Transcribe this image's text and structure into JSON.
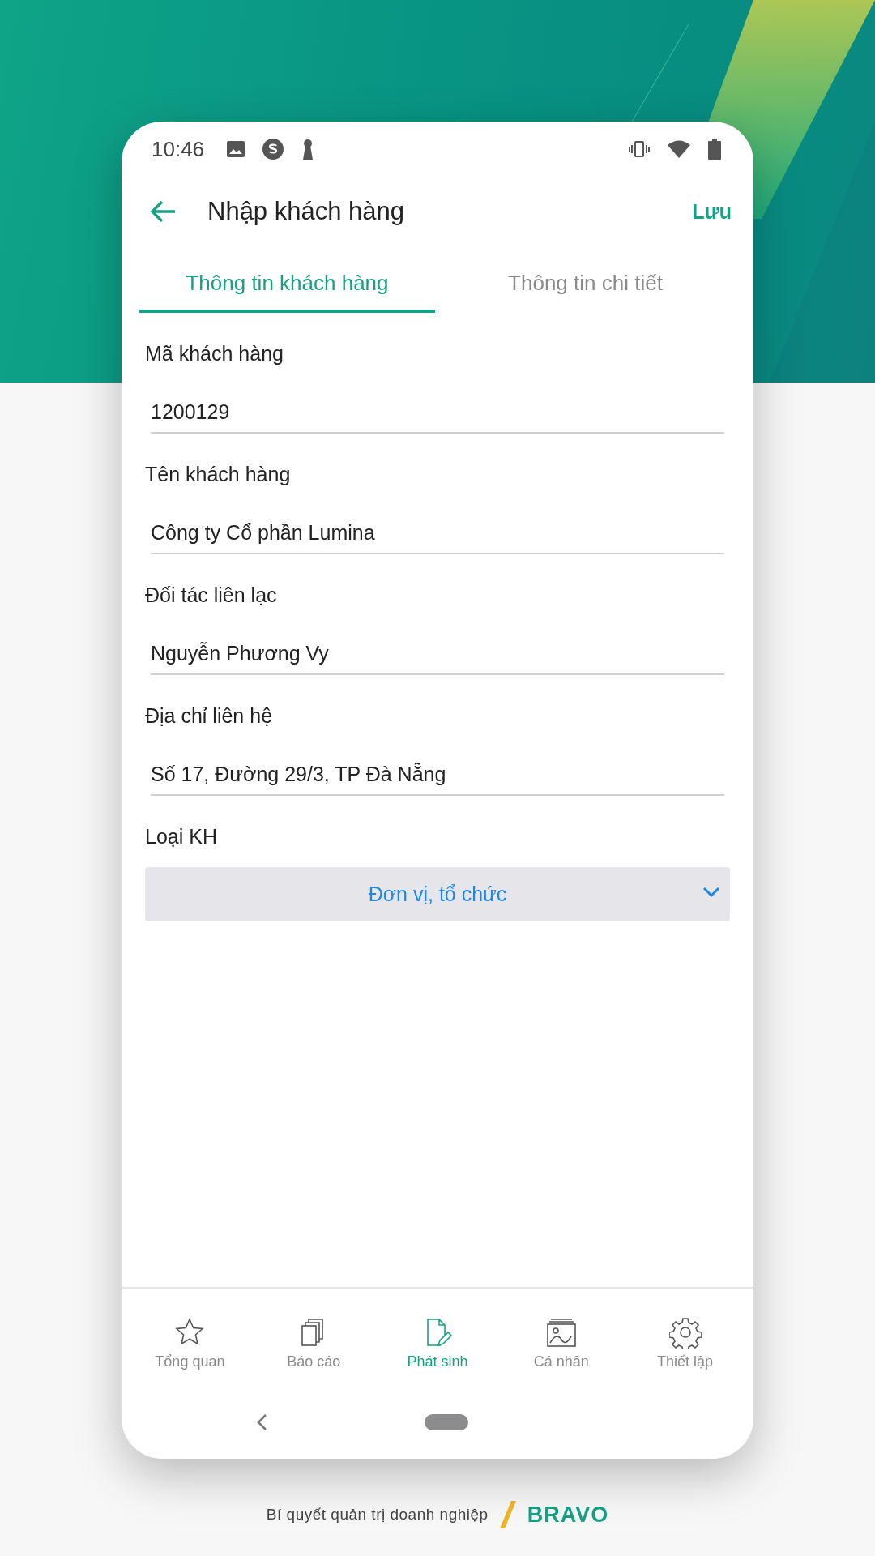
{
  "status_bar": {
    "time": "10:46"
  },
  "header": {
    "title": "Nhập khách hàng",
    "action": "Lưu"
  },
  "tabs": [
    {
      "label": "Thông tin khách hàng",
      "selected": true
    },
    {
      "label": "Thông tin chi tiết",
      "selected": false
    }
  ],
  "fields": [
    {
      "label": "Mã khách hàng",
      "value": "1200129"
    },
    {
      "label": "Tên khách hàng",
      "value": "Công ty Cổ phần Lumina"
    },
    {
      "label": "Đối tác liên lạc",
      "value": "Nguyễn Phương Vy"
    },
    {
      "label": "Địa chỉ liên hệ",
      "value": "Số 17, Đường 29/3, TP Đà Nẵng"
    }
  ],
  "customer_type": {
    "label": "Loại KH",
    "value": "Đơn vị, tổ chức"
  },
  "nav": [
    {
      "label": "Tổng quan",
      "kind": "star",
      "selected": false
    },
    {
      "label": "Báo cáo",
      "kind": "pages",
      "selected": false
    },
    {
      "label": "Phát sinh",
      "kind": "edit",
      "selected": true
    },
    {
      "label": "Cá nhân",
      "kind": "image",
      "selected": false
    },
    {
      "label": "Thiết lập",
      "kind": "gear",
      "selected": false
    }
  ],
  "footer": {
    "slogan": "Bí quyết quản trị doanh nghiệp",
    "brand": "BRAVO"
  }
}
